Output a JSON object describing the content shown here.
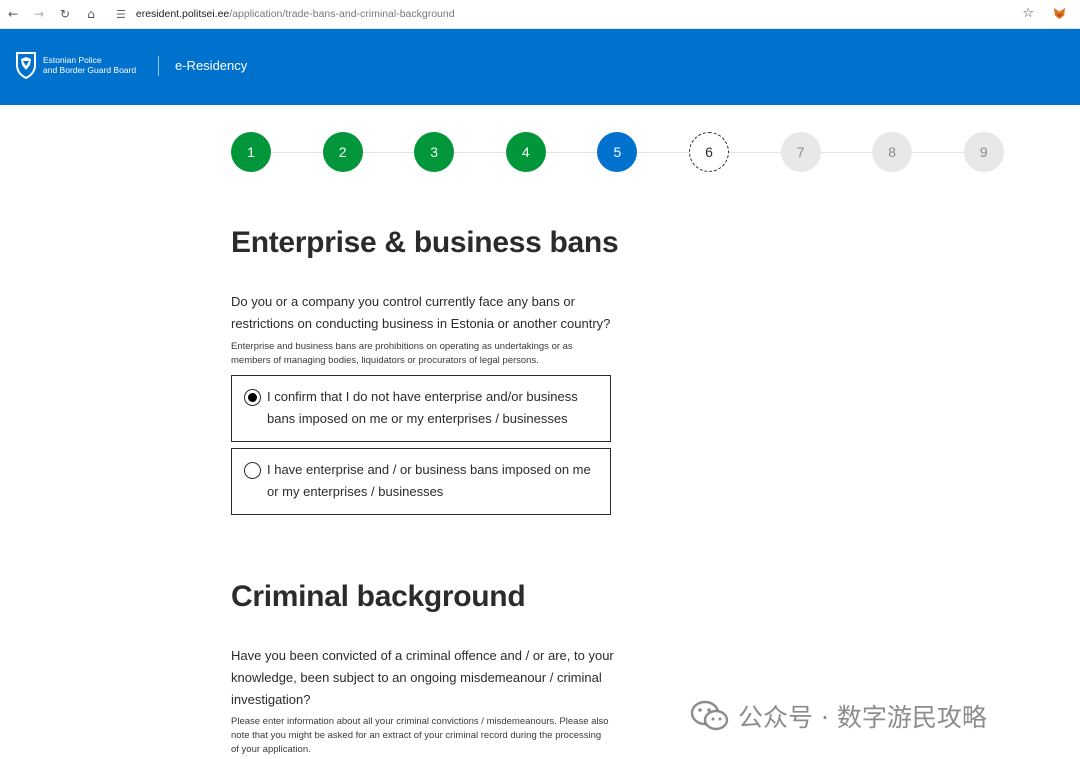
{
  "browser": {
    "url_host": "eresident.politsei.ee",
    "url_path": "/application/trade-bans-and-criminal-background"
  },
  "header": {
    "org_line1": "Estonian Police",
    "org_line2": "and Border Guard Board",
    "brand": "e-Residency",
    "color": "#0072ce"
  },
  "stepper": {
    "steps": [
      {
        "label": "1",
        "state": "done"
      },
      {
        "label": "2",
        "state": "done"
      },
      {
        "label": "3",
        "state": "done"
      },
      {
        "label": "4",
        "state": "done"
      },
      {
        "label": "5",
        "state": "current"
      },
      {
        "label": "6",
        "state": "next"
      },
      {
        "label": "7",
        "state": "future"
      },
      {
        "label": "8",
        "state": "future"
      },
      {
        "label": "9",
        "state": "future"
      }
    ],
    "done_color": "#009639",
    "current_color": "#0072ce"
  },
  "bans": {
    "title": "Enterprise & business bans",
    "question": "Do you or a company you control currently face any bans or restrictions on conducting business in Estonia or another country?",
    "hint": "Enterprise and business bans are prohibitions on operating as undertakings or as members of managing bodies, liquidators or procurators of legal persons.",
    "options": [
      {
        "label": "I confirm that I do not have enterprise and/or business bans imposed on me or my enterprises / businesses",
        "selected": true
      },
      {
        "label": "I have enterprise and / or business bans imposed on me or my enterprises / businesses",
        "selected": false
      }
    ]
  },
  "criminal": {
    "title": "Criminal background",
    "question": "Have you been convicted of a criminal offence and / or are, to your knowledge, been subject to an ongoing misdemeanour / criminal investigation?",
    "hint": "Please enter information about all your criminal convictions / misdemeanours. Please also note that you might be asked for an extract of your criminal record during the processing of your application."
  },
  "watermark": {
    "text": "公众号 · 数字游民攻略"
  }
}
